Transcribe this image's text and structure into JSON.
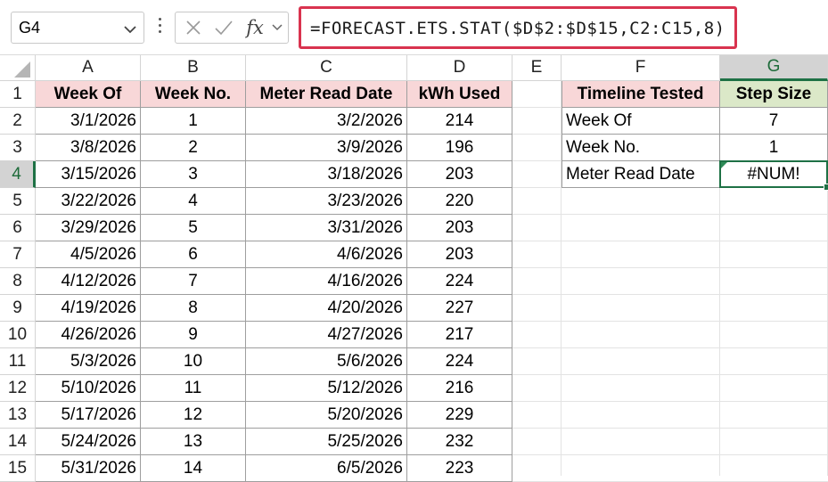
{
  "formula_bar": {
    "name_box": "G4",
    "formula": "=FORECAST.ETS.STAT($D$2:$D$15,C2:C15,8)",
    "fx_label": "fx"
  },
  "columns": [
    "A",
    "B",
    "C",
    "D",
    "E",
    "F",
    "G"
  ],
  "selected_column": "G",
  "rows": [
    "1",
    "2",
    "3",
    "4",
    "5",
    "6",
    "7",
    "8",
    "9",
    "10",
    "11",
    "12",
    "13",
    "14",
    "15"
  ],
  "selected_row": "4",
  "table1": {
    "headers": [
      "Week Of",
      "Week No.",
      "Meter Read Date",
      "kWh Used"
    ],
    "rows": [
      [
        "3/1/2026",
        "1",
        "3/2/2026",
        "214"
      ],
      [
        "3/8/2026",
        "2",
        "3/9/2026",
        "196"
      ],
      [
        "3/15/2026",
        "3",
        "3/18/2026",
        "203"
      ],
      [
        "3/22/2026",
        "4",
        "3/23/2026",
        "220"
      ],
      [
        "3/29/2026",
        "5",
        "3/31/2026",
        "203"
      ],
      [
        "4/5/2026",
        "6",
        "4/6/2026",
        "203"
      ],
      [
        "4/12/2026",
        "7",
        "4/16/2026",
        "224"
      ],
      [
        "4/19/2026",
        "8",
        "4/20/2026",
        "227"
      ],
      [
        "4/26/2026",
        "9",
        "4/27/2026",
        "217"
      ],
      [
        "5/3/2026",
        "10",
        "5/6/2026",
        "224"
      ],
      [
        "5/10/2026",
        "11",
        "5/12/2026",
        "216"
      ],
      [
        "5/17/2026",
        "12",
        "5/20/2026",
        "229"
      ],
      [
        "5/24/2026",
        "13",
        "5/25/2026",
        "232"
      ],
      [
        "5/31/2026",
        "14",
        "6/5/2026",
        "223"
      ]
    ]
  },
  "table2": {
    "headers": [
      "Timeline Tested",
      "Step Size"
    ],
    "rows": [
      [
        "Week Of",
        "7"
      ],
      [
        "Week No.",
        "1"
      ],
      [
        "Meter Read Date",
        "#NUM!"
      ]
    ]
  },
  "colors": {
    "header_pink": "#f8d7d8",
    "header_green": "#dbe8c8",
    "selection_green": "#1e7145",
    "formula_border": "#d9334f"
  },
  "icons": [
    "chevron-down-icon",
    "more-options-icon",
    "cancel-icon",
    "enter-icon",
    "insert-function-icon",
    "error-indicator-icon"
  ]
}
